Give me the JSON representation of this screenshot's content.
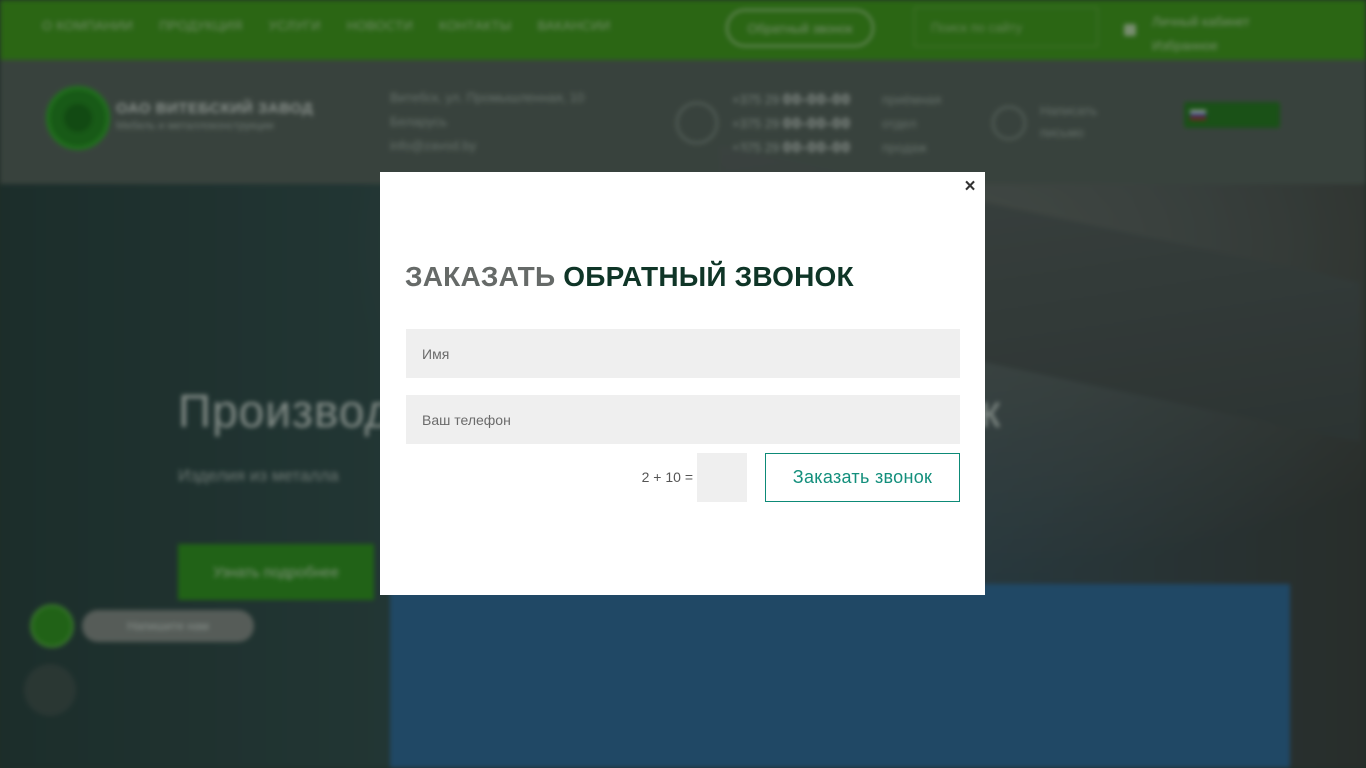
{
  "background_page": {
    "topbar": {
      "nav": [
        "О КОМПАНИИ",
        "ПРОДУКЦИЯ",
        "УСЛУГИ",
        "НОВОСТИ",
        "КОНТАКТЫ",
        "ВАКАНСИИ"
      ],
      "callback_button": "Обратный звонок",
      "search_placeholder": "Поиск по сайту",
      "account_line1": "Личный кабинет",
      "account_line2": "Избранное"
    },
    "header": {
      "brand": "ОАО ВИТЕБСКИЙ ЗАВОД",
      "brand_sub": "Мебель и металлоконструкции",
      "address_line1": "Витебск, ул. Промышленная, 10",
      "address_line2": "Беларусь",
      "address_link": "info@zavod.by",
      "phones": [
        {
          "code": "+375 29",
          "number": "00-00-00",
          "note": "приёмная"
        },
        {
          "code": "+375 29",
          "number": "00-00-00",
          "note": "отдел"
        },
        {
          "code": "+375 29",
          "number": "00-00-00",
          "note": "продаж"
        }
      ],
      "mail_line1": "Написать",
      "mail_line2": "письмо",
      "language": "Русский"
    },
    "hero": {
      "title_start": "Производство",
      "title_end": "к",
      "subtitle": "Изделия из металла",
      "button": "Узнать подробнее",
      "chat_label": "Напишите нам"
    }
  },
  "modal": {
    "close_symbol": "×",
    "title_prefix": "Заказать",
    "title_main": "обратный звонок",
    "name_placeholder": "Имя",
    "phone_placeholder": "Ваш телефон",
    "captcha_question": "2 + 10 =",
    "submit_label": "Заказать звонок"
  },
  "colors": {
    "topbar_green": "#3ea012",
    "submit_border": "#0d8a77",
    "title_dark": "#0f3527"
  }
}
